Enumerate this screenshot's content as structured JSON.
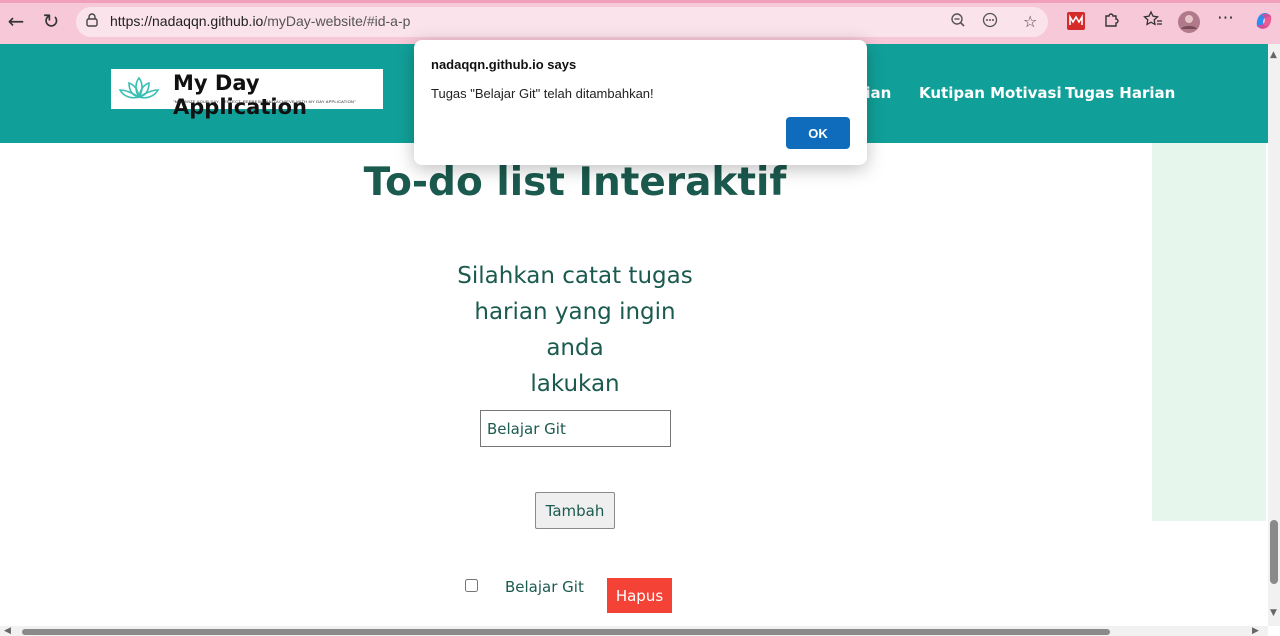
{
  "browser": {
    "url_host": "https://nadaqqn.github.io",
    "url_path": "/myDay-website/#id-a-p"
  },
  "header": {
    "logo_title": "My Day Application",
    "logo_tagline": "\"MAXIMIZE YOUR DAY, REFLECT, REFRESH, AND ACHIEVE WITH MY DAY APPLICATION\"",
    "nav": [
      "rian",
      "Kutipan Motivasi",
      "Tugas Harian"
    ]
  },
  "main": {
    "title": "To-do list Interaktif",
    "subtitle_lines": [
      "Silahkan catat tugas",
      "harian yang ingin anda",
      "lakukan"
    ],
    "input_value": "Belajar Git",
    "add_label": "Tambah",
    "tasks": [
      {
        "label": "Belajar Git",
        "delete_label": "Hapus",
        "checked": false
      }
    ]
  },
  "dialog": {
    "title": "nadaqqn.github.io says",
    "message": "Tugas \"Belajar Git\" telah ditambahkan!",
    "ok_label": "OK"
  },
  "colors": {
    "header_bg": "#11a099",
    "chrome_bg": "#f7c8d8",
    "text_green": "#1b5a4e",
    "delete_red": "#f44336",
    "ok_blue": "#0f6cbd",
    "panel_bg": "#e7f6ec"
  }
}
